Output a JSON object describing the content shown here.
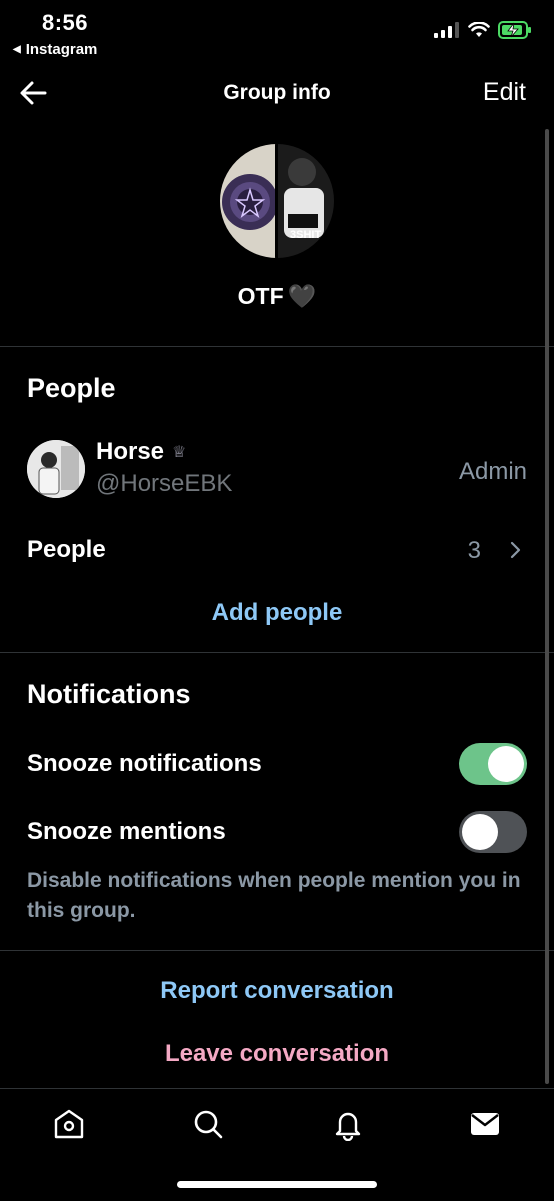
{
  "status_bar": {
    "time": "8:56",
    "back_app": "Instagram",
    "colors": {
      "battery": "#4cd964"
    }
  },
  "header": {
    "title": "Group info",
    "edit_label": "Edit",
    "back_icon": "arrow-left-icon"
  },
  "group": {
    "name": "OTF",
    "name_emoji": "🖤"
  },
  "people_section": {
    "title": "People",
    "member": {
      "name": "Horse",
      "crown_icon": "♕",
      "handle": "@HorseEBK",
      "role": "Admin"
    },
    "people_row_label": "People",
    "people_count": "3",
    "add_people_label": "Add people"
  },
  "notifications_section": {
    "title": "Notifications",
    "snooze_notifications_label": "Snooze notifications",
    "snooze_notifications_on": true,
    "snooze_mentions_label": "Snooze mentions",
    "snooze_mentions_on": false,
    "help_text": "Disable notifications when people mention you in this group."
  },
  "actions": {
    "report_label": "Report conversation",
    "leave_label": "Leave conversation"
  },
  "colors": {
    "link_blue": "#8ec8f6",
    "danger_pink": "#f4a9c4",
    "toggle_on": "#6dc48a",
    "toggle_off": "#4f5256",
    "secondary_text": "#8b98a5"
  },
  "tab_bar": {
    "tabs": [
      "home-icon",
      "search-icon",
      "bell-icon",
      "mail-icon"
    ],
    "active": "mail-icon"
  }
}
